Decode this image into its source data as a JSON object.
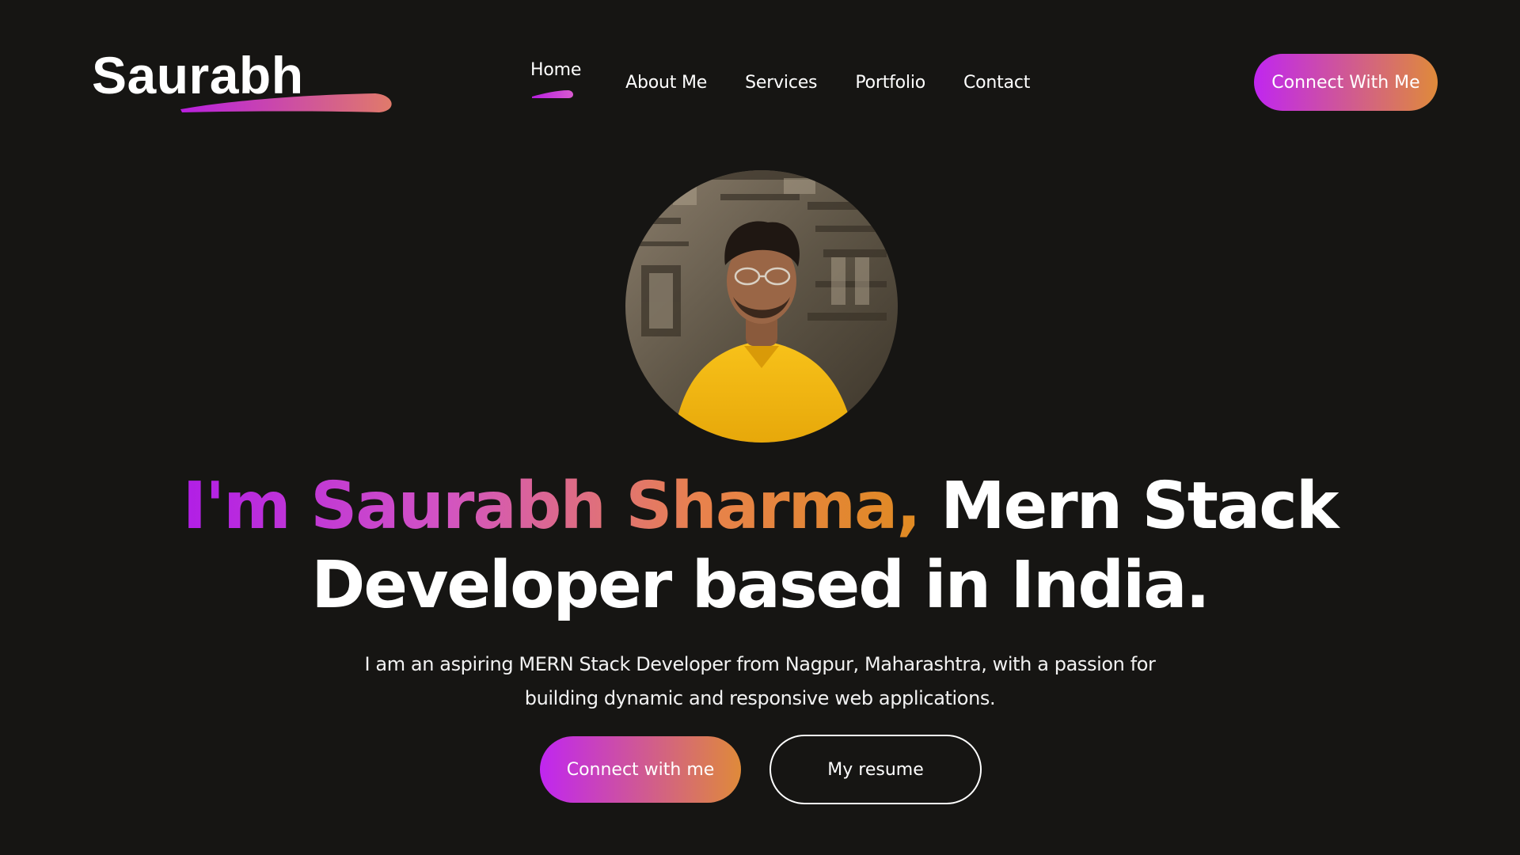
{
  "navbar": {
    "logo_text": "Saurabh",
    "items": [
      {
        "label": "Home",
        "active": true
      },
      {
        "label": "About Me"
      },
      {
        "label": "Services"
      },
      {
        "label": "Portfolio"
      },
      {
        "label": "Contact"
      }
    ],
    "cta_label": "Connect With Me"
  },
  "hero": {
    "headline_highlight": "I'm Saurabh Sharma,",
    "headline_rest_line1": "Mern Stack",
    "headline_line2": "Developer based in India.",
    "intro_line1": "I am an aspiring MERN Stack Developer from Nagpur, Maharashtra, with a passion for",
    "intro_line2": "building dynamic and responsive web applications.",
    "primary_button": "Connect with me",
    "secondary_button": "My resume"
  },
  "colors": {
    "background": "#161513",
    "gradient_start": "#c026f0",
    "gradient_end": "#df8a3a",
    "text": "#ffffff"
  },
  "icons": {
    "logo_underline": "brush-stroke-icon",
    "nav_active_indicator": "brush-stroke-icon"
  }
}
